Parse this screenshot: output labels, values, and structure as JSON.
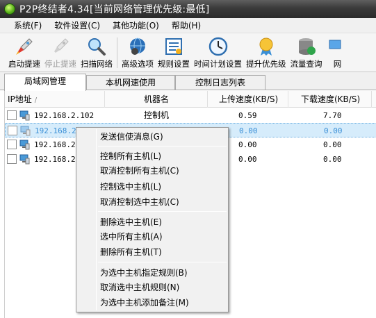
{
  "window": {
    "title": "P2P终结者4.34[当前网络管理优先级:最低]"
  },
  "menubar": [
    "系统(F)",
    "软件设置(C)",
    "其他功能(O)",
    "帮助(H)"
  ],
  "toolbar": [
    {
      "label": "启动提速",
      "icon": "rocket-icon",
      "enabled": true
    },
    {
      "label": "停止提速",
      "icon": "rocket-stop-icon",
      "enabled": false
    },
    {
      "label": "扫描网络",
      "icon": "magnifier-icon",
      "enabled": true
    },
    {
      "label": "高级选项",
      "icon": "globe-gear-icon",
      "enabled": true
    },
    {
      "label": "规则设置",
      "icon": "rules-icon",
      "enabled": true
    },
    {
      "label": "时间计划设置",
      "icon": "clock-icon",
      "enabled": true
    },
    {
      "label": "提升优先级",
      "icon": "medal-icon",
      "enabled": true
    },
    {
      "label": "流量查询",
      "icon": "database-icon",
      "enabled": true
    },
    {
      "label": "网",
      "icon": "network-icon",
      "enabled": true
    }
  ],
  "tabs": [
    "局域网管理",
    "本机网速使用",
    "控制日志列表"
  ],
  "table": {
    "headers": {
      "ip": "IP地址",
      "sort": "/",
      "name": "机器名",
      "up": "上传速度(KB/S)",
      "down": "下载速度(KB/S)"
    },
    "rows": [
      {
        "ip": "192.168.2.102",
        "name": "控制机",
        "up": "0.59",
        "down": "7.70"
      },
      {
        "ip": "192.168.2.",
        "name": "",
        "up": "0.00",
        "down": "0.00"
      },
      {
        "ip": "192.168.2.",
        "name": "",
        "up": "0.00",
        "down": "0.00"
      },
      {
        "ip": "192.168.2.",
        "name": "",
        "up": "0.00",
        "down": "0.00"
      }
    ]
  },
  "context_menu": [
    "发送信使消息(G)",
    "控制所有主机(L)",
    "取消控制所有主机(C)",
    "控制选中主机(L)",
    "取消控制选中主机(C)",
    "删除选中主机(E)",
    "选中所有主机(A)",
    "删除所有主机(T)",
    "为选中主机指定规则(B)",
    "取消选中主机规则(N)",
    "为选中主机添加备注(M)"
  ],
  "colors": {
    "titlebar": "#3a3a3a",
    "selected_row": "#d6ecfb",
    "selected_text": "#3a8fd6"
  }
}
